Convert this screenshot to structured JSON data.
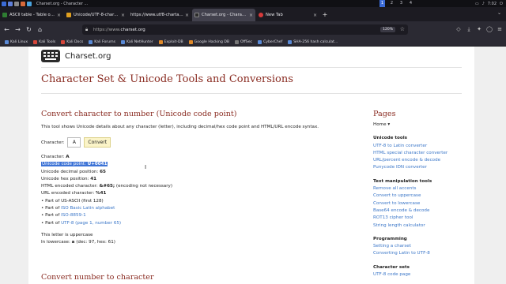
{
  "os": {
    "window_title": "Charset.org - Character ...",
    "workspaces": [
      "1",
      "2",
      "3",
      "4"
    ],
    "active_workspace": "1",
    "clock": "7:02"
  },
  "tabs": [
    {
      "label": "ASCII table - Table of AS",
      "color": "#2e7d32"
    },
    {
      "label": "Unicode/UTF-8-characte",
      "color": "#e0a020"
    },
    {
      "label": "https://www.utf8-chartable",
      "color": "#888888"
    },
    {
      "label": "Charset.org - Character S",
      "color": "#2b2b2b",
      "active": true
    },
    {
      "label": "New Tab",
      "color": "#d63a3a"
    }
  ],
  "nav": {
    "url_prefix": "https://www.",
    "url_domain": "charset.org",
    "zoom": "120%"
  },
  "bookmarks": [
    {
      "label": "Kali Linux",
      "icon": "kali-icon"
    },
    {
      "label": "Kali Tools",
      "icon": "kali-icon",
      "color": "red"
    },
    {
      "label": "Kali Docs",
      "icon": "kali-icon",
      "color": "red"
    },
    {
      "label": "Kali Forums",
      "icon": "kali-icon"
    },
    {
      "label": "Kali NetHunter",
      "icon": "kali-icon"
    },
    {
      "label": "Exploit-DB",
      "icon": "exploit-db-icon",
      "color": "orange"
    },
    {
      "label": "Google Hacking DB",
      "icon": "ghdb-icon",
      "color": "orange"
    },
    {
      "label": "OffSec",
      "icon": "offsec-icon",
      "color": "gray"
    },
    {
      "label": "CyberChef",
      "icon": "cyberchef-icon"
    },
    {
      "label": "SHA-256 hash calculat...",
      "icon": "hash-icon"
    }
  ],
  "site": {
    "logo_text": "Charset.org",
    "title": "Character Set & Unicode Tools and Conversions"
  },
  "main": {
    "heading": "Convert character to number (Unicode code point)",
    "intro": "This tool shows Unicode details about any character (letter), including decimal/hex code point and HTML/URL encode syntax.",
    "char_label": "Character:",
    "char_value": "A",
    "convert_label": "Convert",
    "result_char_label": "Character:",
    "result_char": "A",
    "codepoint_label": "Unicode code point:",
    "codepoint_value": "U+0041",
    "decimal_label": "Unicode decimal position:",
    "decimal_value": "65",
    "hex_label": "Unicode hex position:",
    "hex_value": "41",
    "html_label": "HTML encoded character:",
    "html_value": "&#65;",
    "html_note": "(encoding not necessary)",
    "url_label": "URL encoded character:",
    "url_value": "%41",
    "part1": "Part of US-ASCII (first 128)",
    "part2_prefix": "Part of",
    "part2_link": "ISO Basic Latin alphabet",
    "part3_prefix": "Part of",
    "part3_link": "ISO-8859-1",
    "part4_prefix": "Part of",
    "part4_link": "UTF-8 (page 1, number 65)",
    "case_note": "This letter is uppercase",
    "lower_label": "In lowercase:",
    "lower_char": "a",
    "lower_detail": "(dec: 97, hex: 61)",
    "next_heading": "Convert number to character"
  },
  "sidebar": {
    "heading": "Pages",
    "home": "Home",
    "sections": [
      {
        "title": "Unicode tools",
        "links": [
          "UTF-8 to Latin converter",
          "HTML special character converter",
          "URL/percent encode & decode",
          "Punycode IDN converter"
        ]
      },
      {
        "title": "Text manipulation tools",
        "links": [
          "Remove all accents",
          "Convert to uppercase",
          "Convert to lowercase",
          "Base64 encode & decode",
          "ROT13 cipher tool",
          "String length calculator"
        ]
      },
      {
        "title": "Programming",
        "links": [
          "Setting a charset",
          "Converting Latin to UTF-8"
        ]
      },
      {
        "title": "Character sets",
        "links": [
          "UTF-8 code page"
        ]
      }
    ]
  }
}
